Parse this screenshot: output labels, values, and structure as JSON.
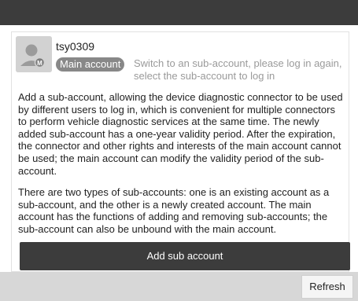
{
  "account": {
    "username": "tsy0309",
    "badge_label": "Main account",
    "switch_hint": "Switch to an sub-account, please log in again, select the sub-account to log in",
    "avatar_icon": "user-avatar-icon",
    "avatar_mark": "M"
  },
  "description": {
    "paragraph1": "Add a sub-account, allowing the device diagnostic connector to be used by different users to log in, which is convenient for multiple connectors to perform vehicle diagnostic services at the same time. The newly added sub-account has a one-year validity period. After the expiration, the connector and other rights and interests of the main account cannot be used; the main account can modify the validity period of the sub-account.",
    "paragraph2": "There are two types of sub-accounts: one is an existing account as a sub-account, and the other is a newly created account. The main account has the functions of adding and removing sub-accounts; the sub-account can also be unbound with the main account."
  },
  "actions": {
    "add_sub_account_label": "Add sub account",
    "refresh_label": "Refresh"
  },
  "colors": {
    "top_bar": "#3c3c3c",
    "button_dark": "#3c3c3c",
    "badge": "#888888",
    "hint_text": "#9a9a9a",
    "bottom_bar": "#d7d7d7"
  }
}
